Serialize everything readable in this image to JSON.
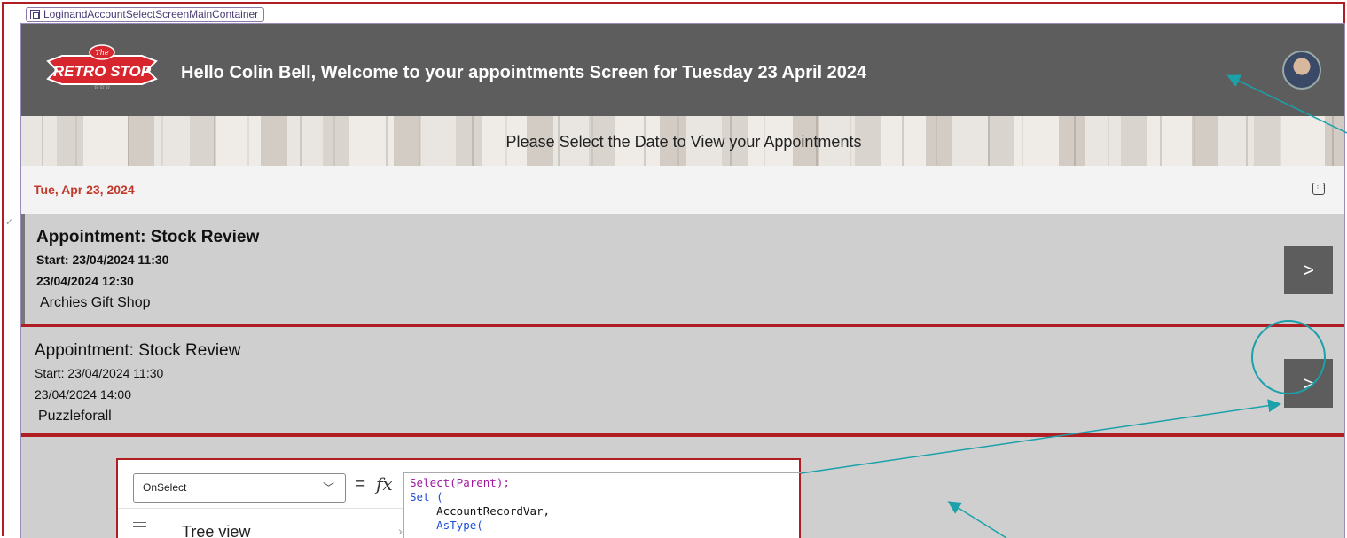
{
  "container_label": "LoginandAccountSelectScreenMainContainer",
  "header": {
    "logo_alt": "The Retro Stop",
    "logo_small": "The",
    "logo_main": "RETRO STOP",
    "welcome_text": "Hello Colin Bell, Welcome to your appointments Screen for Tuesday 23 April 2024",
    "avatar_icon": "user-avatar"
  },
  "banner": {
    "text": "Please Select the Date to View your Appointments"
  },
  "date_picker": {
    "value": "Tue, Apr 23, 2024",
    "icon": "calendar-icon"
  },
  "appointments": [
    {
      "title": "Appointment: Stock Review",
      "start": "Start: 23/04/2024 11:30",
      "end": "23/04/2024 12:30",
      "store": "Archies Gift Shop",
      "button_label": ">"
    },
    {
      "title": "Appointment: Stock Review",
      "start": "Start: 23/04/2024 11:30",
      "end": "23/04/2024 14:00",
      "store": "Puzzleforall",
      "button_label": ">"
    }
  ],
  "formula_panel": {
    "property": "OnSelect",
    "equals": "=",
    "fx": "fx",
    "formula_lines": [
      "Select(Parent);",
      "Set (",
      "    AccountRecordVar,",
      "    AsType("
    ],
    "tree_view_label": "Tree view"
  },
  "colors": {
    "header_bg": "#5d5d5d",
    "accent_red": "#b01e24",
    "date_text": "#c0392b",
    "annotation_teal": "#1aa1aa"
  }
}
